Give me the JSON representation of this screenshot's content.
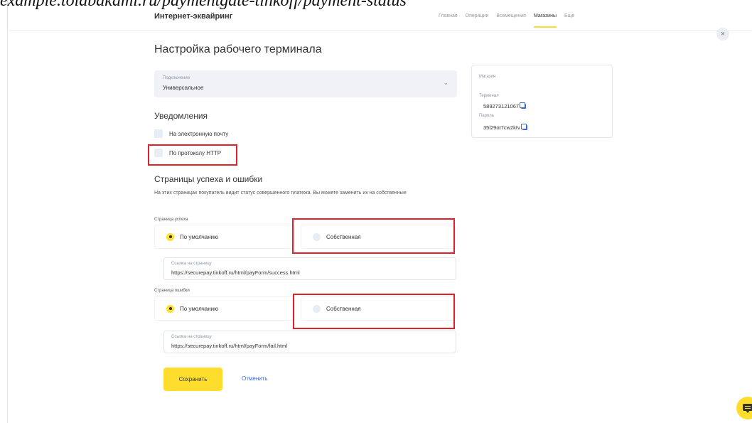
{
  "caption": "example.tolabakami.ru/paymentgate-tinkoff/payment-status",
  "header": {
    "app_title": "Интернет-эквайринг",
    "nav": [
      "Главная",
      "Операции",
      "Возмещения",
      "Магазины",
      "Еще"
    ],
    "active_nav": "Магазины"
  },
  "page": {
    "title": "Настройка рабочего терминала",
    "close_label": "×"
  },
  "connection": {
    "label": "Подключение",
    "value": "Универсальное"
  },
  "notifications": {
    "heading": "Уведомления",
    "email_label": "На электронную почту",
    "http_label": "По протоколу HTTP"
  },
  "pages_section": {
    "heading": "Страницы успеха и ошибки",
    "description": "На этих страницах покупатель видит статус совершенного платежа. Вы можете заменить их на собственные",
    "success": {
      "label": "Страница успеха",
      "option_default": "По умолчанию",
      "option_custom": "Собственная",
      "link_label": "Ссылка на страницу",
      "link_value": "https://securepay.tinkoff.ru/html/payForm/success.html"
    },
    "fail": {
      "label": "Страница ошибки",
      "option_default": "По умолчанию",
      "option_custom": "Собственная",
      "link_label": "Ссылка на страницу",
      "link_value": "https://securepay.tinkoff.ru/html/payForm/fail.html"
    }
  },
  "actions": {
    "save_label": "Сохранить",
    "cancel_label": "Отменить"
  },
  "side_card": {
    "shop_label": "Магазин",
    "terminal_label": "Терминал",
    "terminal_value": "589273121067",
    "password_label": "Пароль",
    "password_value": "35l29ot7cw2ktv"
  },
  "colors": {
    "accent": "#ffdd2d",
    "highlight": "#e0202a",
    "link": "#3a6ad6"
  },
  "icons": [
    "close-icon",
    "chevron-down-icon",
    "copy-icon",
    "chat-icon"
  ]
}
